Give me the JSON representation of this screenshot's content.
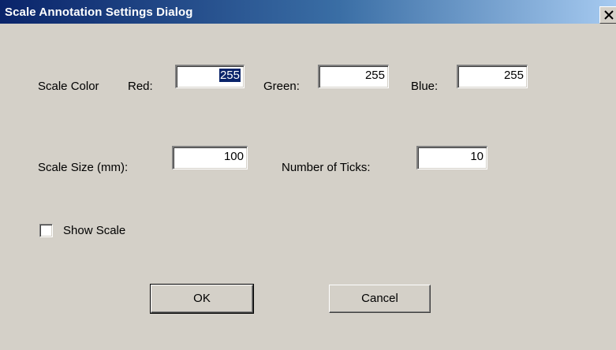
{
  "window": {
    "title": "Scale Annotation Settings Dialog",
    "close_glyph": "✕"
  },
  "scale_color": {
    "label": "Scale Color",
    "red_label": "Red:",
    "red_value": "255",
    "green_label": "Green:",
    "green_value": "255",
    "blue_label": "Blue:",
    "blue_value": "255"
  },
  "scale_size": {
    "label": "Scale Size (mm):",
    "value": "100"
  },
  "ticks": {
    "label": "Number of Ticks:",
    "value": "10"
  },
  "show_scale": {
    "label": "Show Scale",
    "checked": false
  },
  "buttons": {
    "ok_label": "OK",
    "cancel_label": "Cancel"
  },
  "colors": {
    "face": "#d4d0c8",
    "title_start": "#0a246a",
    "title_end": "#a6caf0",
    "selection": "#0a246a"
  },
  "icons": {
    "close": "close-icon"
  }
}
